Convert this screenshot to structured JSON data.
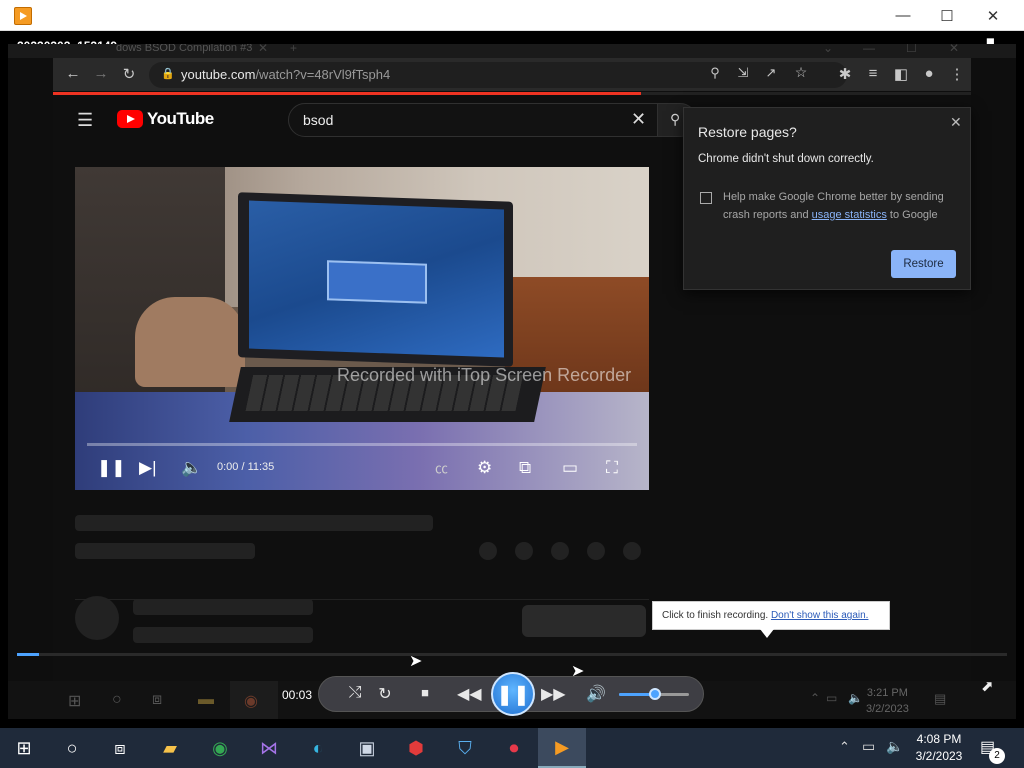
{
  "window": {
    "title": "20230302_152149",
    "minimize": "—",
    "maximize": "☐",
    "close": "✕"
  },
  "recorded_chrome": {
    "tab_title_partial": "dows BSOD Compilation #3",
    "url_host": "youtube.com",
    "url_path": "/watch?v=48rVl9fTsph4",
    "loading_progress": 0.64
  },
  "youtube": {
    "brand": "YouTube",
    "search_query": "bsod",
    "video_time": "0:00 / 11:35",
    "watermark": "Recorded with iTop Screen Recorder"
  },
  "restore_dialog": {
    "title": "Restore pages?",
    "message": "Chrome didn't shut down correctly.",
    "help_before": "Help make Google Chrome better by sending crash reports and ",
    "help_link": "usage statistics",
    "help_after": " to Google",
    "button": "Restore",
    "checked": false
  },
  "recorded_taskbar": {
    "time": "3:21 PM",
    "date": "3/2/2023"
  },
  "tooltip": {
    "text": "Click to finish recording. ",
    "link": "Don't show this again."
  },
  "player": {
    "elapsed": "00:03",
    "seek_fraction": 0.022,
    "volume": 0.52
  },
  "taskbar": {
    "time": "4:08 PM",
    "date": "3/2/2023",
    "notification_count": "2"
  },
  "colors": {
    "accent": "#4da3ff",
    "chrome_link": "#8ab4f8",
    "youtube_red": "#ff0000",
    "taskbar": "#1f2a3a"
  }
}
